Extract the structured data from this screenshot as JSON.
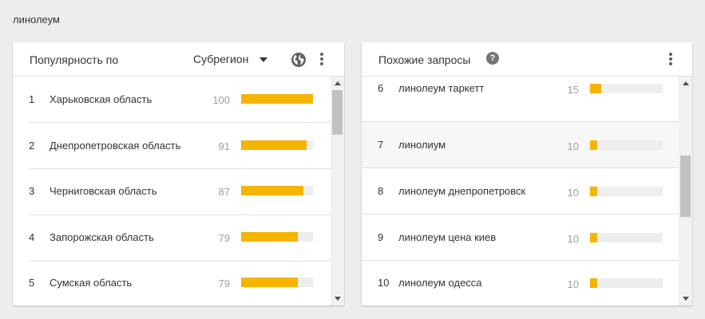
{
  "search_term": "линолеум",
  "colors": {
    "bar_fill": "#f4b400",
    "bar_track": "#eeeeee"
  },
  "regions_card": {
    "title": "Популярность по",
    "resolution_select": "Субрегион",
    "icons": [
      "globe-icon",
      "more-vert-icon"
    ],
    "rows": [
      {
        "rank": "1",
        "name": "Харьковская область",
        "value": "100",
        "fraction": 1.0
      },
      {
        "rank": "2",
        "name": "Днепропетровская область",
        "value": "91",
        "fraction": 0.91
      },
      {
        "rank": "3",
        "name": "Черниговская область",
        "value": "87",
        "fraction": 0.87
      },
      {
        "rank": "4",
        "name": "Запорожская область",
        "value": "79",
        "fraction": 0.79
      },
      {
        "rank": "5",
        "name": "Сумская область",
        "value": "79",
        "fraction": 0.79
      }
    ]
  },
  "queries_card": {
    "title": "Похожие запросы",
    "help_icon": "?",
    "icons": [
      "help-icon",
      "more-vert-icon"
    ],
    "rows": [
      {
        "rank": "6",
        "name": "линолеум таркетт",
        "value": "15",
        "fraction": 0.15
      },
      {
        "rank": "7",
        "name": "линолиум",
        "value": "10",
        "fraction": 0.1
      },
      {
        "rank": "8",
        "name": "линолеум днепропетровск",
        "value": "10",
        "fraction": 0.1
      },
      {
        "rank": "9",
        "name": "линолеум цена киев",
        "value": "10",
        "fraction": 0.1
      },
      {
        "rank": "10",
        "name": "линолеум одесса",
        "value": "10",
        "fraction": 0.1
      }
    ]
  }
}
